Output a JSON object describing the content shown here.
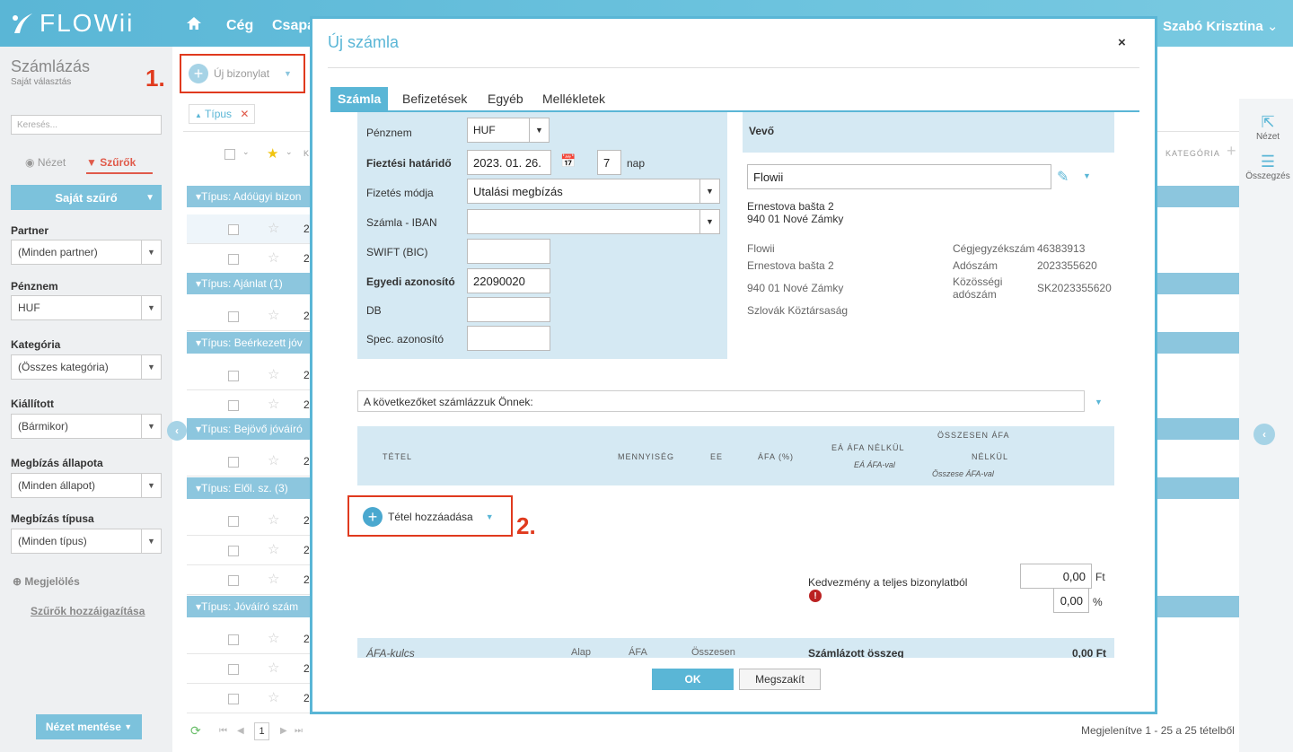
{
  "app": {
    "logo": "FLOWii",
    "nav": [
      "Cég",
      "Csapat"
    ],
    "user": "Szabó Krisztina"
  },
  "sidebar": {
    "title": "Számlázás",
    "subtitle": "Saját választás",
    "search_placeholder": "Keresés...",
    "view_tab": "Nézet",
    "filter_tab": "Szűrők",
    "own_filter": "Saját szűrő",
    "filters": [
      {
        "label": "Partner",
        "value": "(Minden partner)"
      },
      {
        "label": "Pénznem",
        "value": "HUF"
      },
      {
        "label": "Kategória",
        "value": "(Összes kategória)"
      },
      {
        "label": "Kiállított",
        "value": "(Bármikor)"
      },
      {
        "label": "Megbízás állapota",
        "value": "(Minden állapot)"
      },
      {
        "label": "Megbízás típusa",
        "value": "(Minden típus)"
      }
    ],
    "marking": "Megjelölés",
    "filter_link": "Szűrők hozzáigazítása",
    "save_view": "Nézet mentése"
  },
  "list": {
    "new_doc": "Új bizonylat",
    "type_tag": "Típus",
    "col_k": "K",
    "col_category": "KATEGÓRIA",
    "groups": [
      "Típus: Adóügyi bizon",
      "Típus: Ajánlat (1)",
      "Típus: Beérkezett jóv",
      "Típus: Bejövő jóváíró",
      "Típus: Elől. sz. (3)",
      "Típus: Jóváíró szám"
    ],
    "row_prefix": "2",
    "pager": {
      "page": "1"
    },
    "footer": "Megjelenítve 1 - 25 a 25 tételből"
  },
  "rightbar": {
    "view": "Nézet",
    "summary": "Összegzés"
  },
  "steps": {
    "one": "1.",
    "two": "2."
  },
  "modal": {
    "title": "Új számla",
    "close": "×",
    "tabs": [
      "Számla",
      "Befizetések",
      "Egyéb",
      "Mellékletek"
    ],
    "form": {
      "currency_label": "Pénznem",
      "currency": "HUF",
      "due_label": "Fieztési határidő",
      "due_date": "2023. 01. 26.",
      "due_days": "7",
      "days_unit": "nap",
      "payment_label": "Fizetés módja",
      "payment": "Utalási megbízás",
      "iban_label": "Számla - IBAN",
      "iban": "",
      "swift_label": "SWIFT (BIC)",
      "swift": "",
      "uid_label": "Egyedi azonosító",
      "uid": "22090020",
      "db_label": "DB",
      "db": "",
      "spec_label": "Spec. azonosító",
      "spec": ""
    },
    "buyer": {
      "header": "Vevő",
      "name": "Flowii",
      "addr1": "Ernestova bašta 2",
      "addr2": "940 01 Nové Zámky",
      "info": [
        "Flowii",
        "Ernestova bašta 2",
        "940 01 Nové Zámky",
        "Szlovák Köztársaság"
      ],
      "reg_label": "Cégjegyzékszám",
      "reg": "46383913",
      "tax_label": "Adószám",
      "tax": "2023355620",
      "eu_label1": "Közösségi",
      "eu_label2": "adószám",
      "eu": "SK2023355620"
    },
    "intro_text": "A következőket számlázzuk Önnek:",
    "table": {
      "item": "TÉTEL",
      "qty": "MENNYISÉG",
      "unit": "EE",
      "vat": "ÁFA (%)",
      "unit_net": "EÁ ÁFA NÉLKÜL",
      "unit_gross": "EÁ ÁFA-val",
      "total_net1": "ÖSSZESEN ÁFA",
      "total_net2": "NÉLKÜL",
      "total_gross": "Összese ÁFA-val"
    },
    "add_item": "Tétel hozzáadása",
    "discount_label": "Kedvezmény a teljes bizonylatból",
    "discount_amount": "0,00",
    "discount_unit": "Ft",
    "discount_pct": "0,00",
    "pct_unit": "%",
    "summary": {
      "vat_rate": "ÁFA-kulcs",
      "base": "Alap",
      "vat": "ÁFA",
      "total": "Összesen",
      "invoiced": "Számlázott összeg",
      "invoiced_value": "0,00 Ft"
    },
    "ok": "OK",
    "cancel": "Megszakít"
  },
  "colors": {
    "accent": "#5ab6d6",
    "red": "#e03a1e",
    "group": "#8cc6de",
    "panel": "#d5e9f3"
  }
}
